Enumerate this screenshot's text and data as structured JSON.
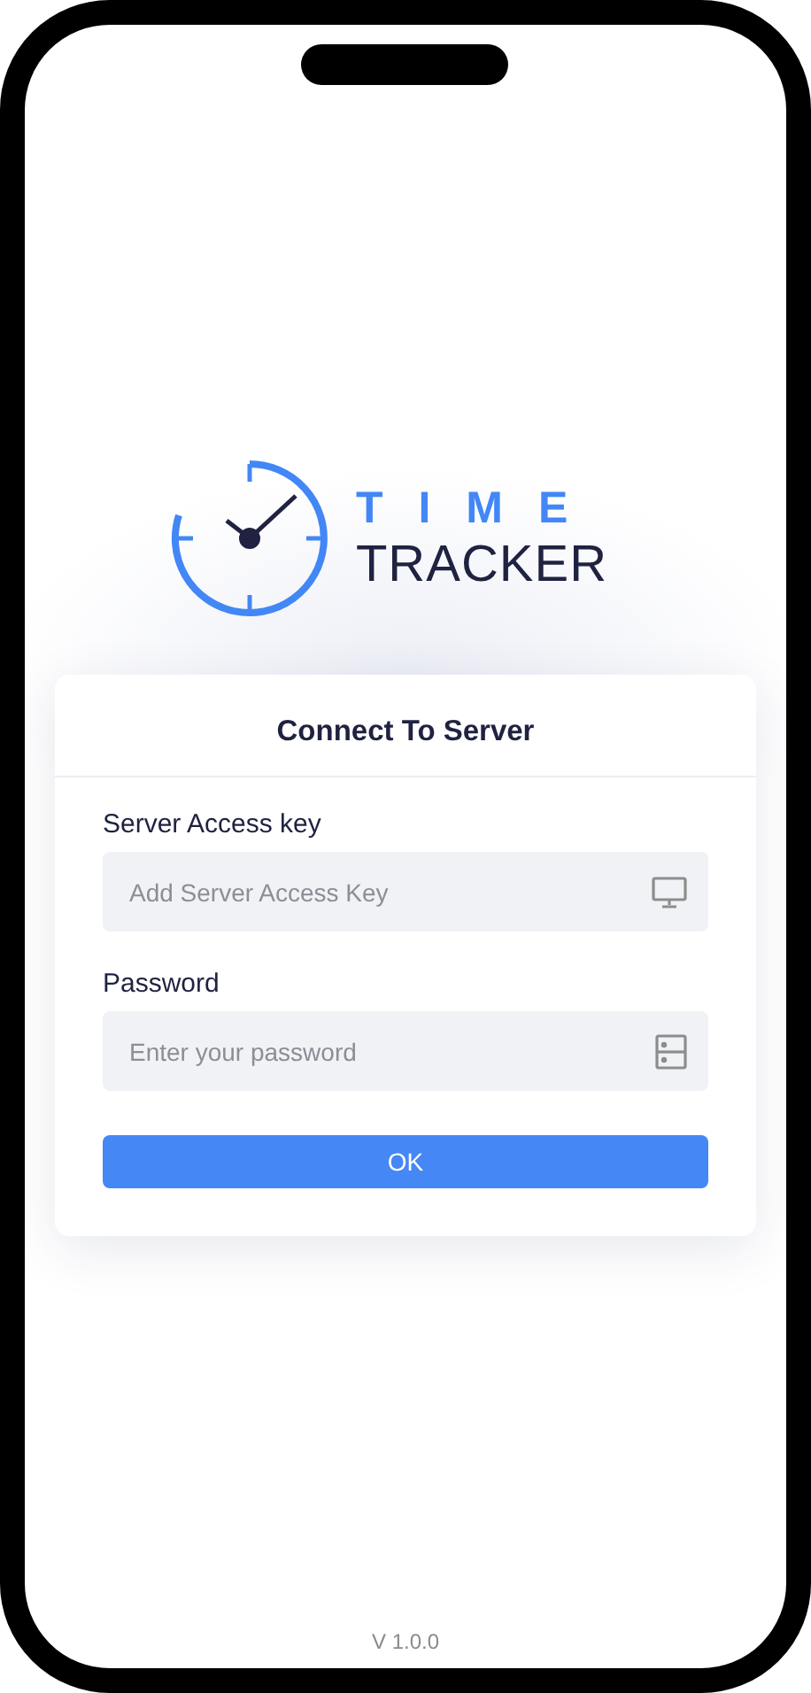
{
  "logo": {
    "line_1": "TIME",
    "line_2": "TRACKER"
  },
  "card": {
    "title": "Connect To Server",
    "fields": [
      {
        "label": "Server Access key",
        "placeholder": "Add Server Access Key",
        "kind": "monitor"
      },
      {
        "label": "Password",
        "placeholder": "Enter your password",
        "kind": "server"
      }
    ],
    "button": "OK"
  },
  "version": "V 1.0.0"
}
